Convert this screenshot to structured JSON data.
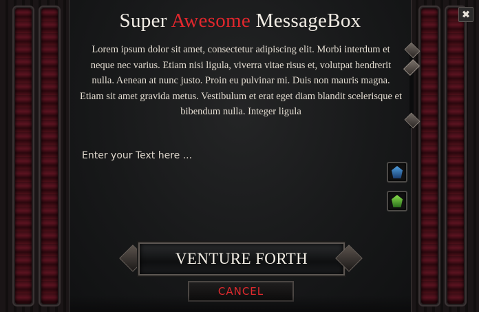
{
  "dialog": {
    "title_prefix": "Super ",
    "title_highlight": "Awesome",
    "title_suffix": " MessageBox",
    "message": "Lorem ipsum dolor sit amet, consectetur adipiscing elit. Morbi interdum et neque nec varius. Etiam nisi ligula, viverra vitae risus et, volutpat hendrerit nulla. Aenean at nunc justo. Proin eu pulvinar mi. Duis non mauris magna. Etiam sit amet gravida metus. Vestibulum et erat eget diam blandit scelerisque et bibendum nulla. Integer ligula",
    "input_placeholder": "Enter your Text here ...",
    "primary_label": "VENTURE FORTH",
    "cancel_label": "CANCEL",
    "close_label": "✖"
  },
  "colors": {
    "title_accent": "#e0272d",
    "cancel_text": "#e02a2e",
    "velvet": "#5a1320",
    "up_gem": "#4fa0e0",
    "down_gem": "#8ae04c"
  },
  "icons": {
    "close": "close-icon",
    "scroll_up": "scroll-up-arrow-icon",
    "scroll_down": "scroll-down-arrow-icon",
    "move_up": "gem-up-icon",
    "move_down": "gem-down-icon"
  }
}
